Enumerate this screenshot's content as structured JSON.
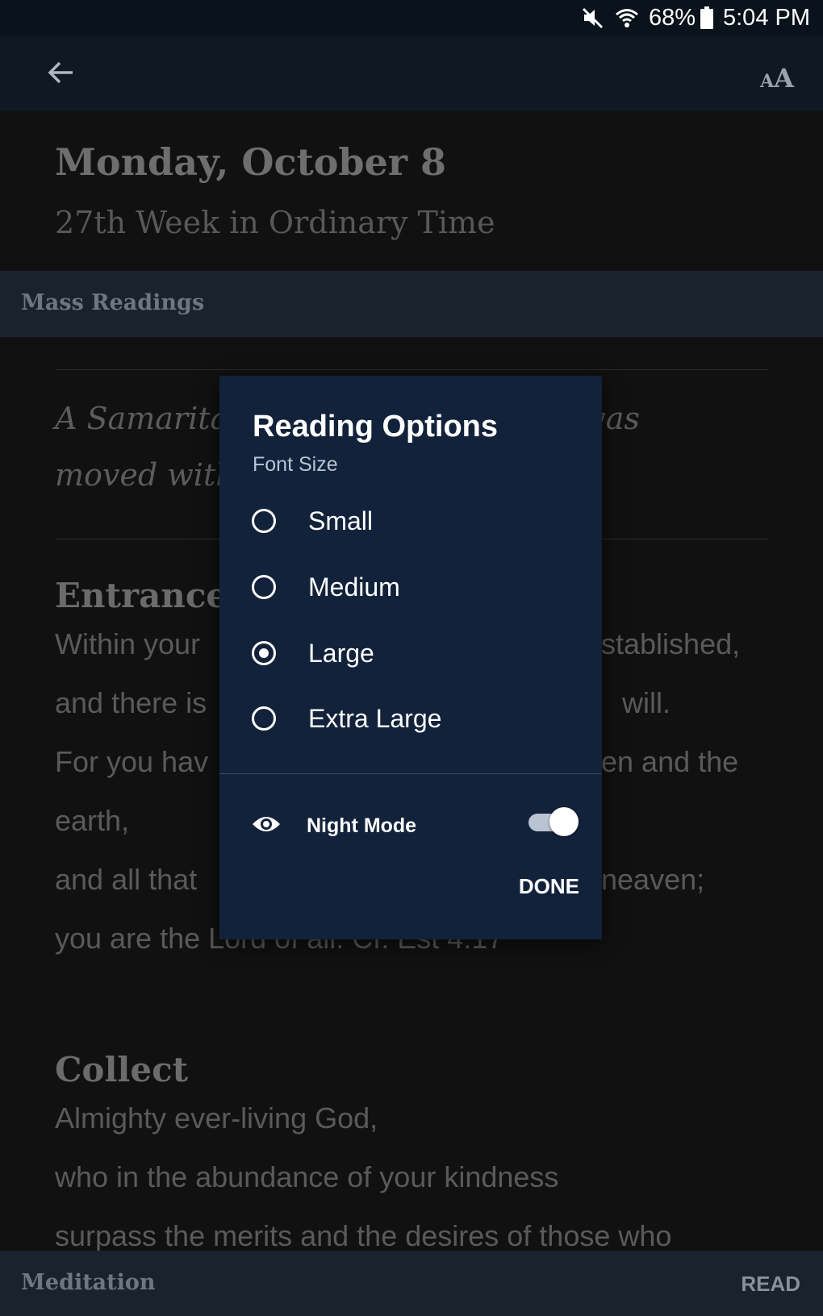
{
  "status_bar": {
    "battery": "68%",
    "time": "5:04 PM",
    "icons": [
      "mute-icon",
      "wifi-icon",
      "battery-icon"
    ]
  },
  "header": {
    "back_icon": "arrow-left-icon",
    "font_small_a": "A",
    "font_big_a": "A"
  },
  "day": {
    "title": "Monday, October 8",
    "subtitle": "27th Week in Ordinary Time"
  },
  "section": {
    "label": "Mass Readings"
  },
  "reading": {
    "antiphon_lines": [
      "A Samarita                             him was",
      "moved with"
    ],
    "entrance_heading": "Entrance",
    "entrance_lines": [
      "Within your",
      "and there is",
      "For you hav",
      "earth,",
      "and all that",
      "you are the Lord of all. Cf. Est 4:17"
    ],
    "entrance_right_fragments": [
      "stablished,",
      "will.",
      "en and the",
      "",
      "neaven;"
    ],
    "collect_heading": "Collect",
    "collect_lines": [
      "Almighty ever-living God,",
      "who in the abundance of your kindness",
      "surpass the merits and the desires of those who"
    ]
  },
  "bottom_bar": {
    "left": "Meditation",
    "right": "READ"
  },
  "dialog": {
    "title": "Reading Options",
    "subtitle": "Font Size",
    "options": [
      {
        "label": "Small",
        "checked": false
      },
      {
        "label": "Medium",
        "checked": false
      },
      {
        "label": "Large",
        "checked": true
      },
      {
        "label": "Extra Large",
        "checked": false
      }
    ],
    "night_mode_label": "Night Mode",
    "night_mode_on": true,
    "night_icon": "eye-icon",
    "done_label": "DONE"
  }
}
